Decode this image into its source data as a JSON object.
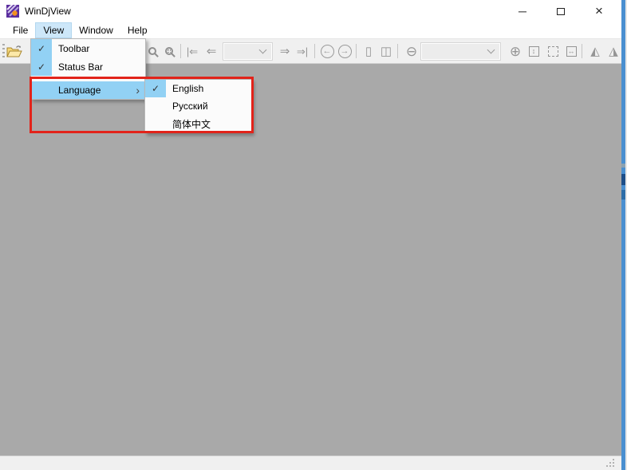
{
  "window": {
    "title": "WinDjView"
  },
  "window_controls": {
    "minimize": "─",
    "close": "×"
  },
  "menubar": {
    "items": [
      "File",
      "View",
      "Window",
      "Help"
    ]
  },
  "view_menu": {
    "items": [
      {
        "label": "Toolbar",
        "checked": true
      },
      {
        "label": "Status Bar",
        "checked": true
      },
      {
        "label": "Language",
        "has_submenu": true
      }
    ]
  },
  "language_submenu": {
    "items": [
      {
        "label": "English",
        "checked": true
      },
      {
        "label": "Русский",
        "checked": false
      },
      {
        "label": "简体中文",
        "checked": false
      }
    ]
  },
  "toolbar": {
    "page_combo_value": "",
    "zoom_combo_value": ""
  },
  "glyphs": {
    "check": "✓",
    "submenu_arrow": "›",
    "first_page": "|⇐",
    "prev_page": "⇐",
    "next_page": "⇒",
    "last_page": "⇒|",
    "back": "←",
    "forward": "→",
    "zoom_out": "⊖",
    "zoom_in": "⊕",
    "single_page": "▯",
    "facing_pages": "◫",
    "fit_width": "↔",
    "actual_size": "↕",
    "rotate_left": "◭",
    "rotate_right": "◮"
  },
  "status": {
    "text": ""
  },
  "colors": {
    "menu_highlight": "#92d1f4",
    "menubar_active": "#cde7f9",
    "annotation_red": "#e2231a",
    "client_gray": "#a9a9a9",
    "toolbar_bg": "#f0f0f0"
  }
}
